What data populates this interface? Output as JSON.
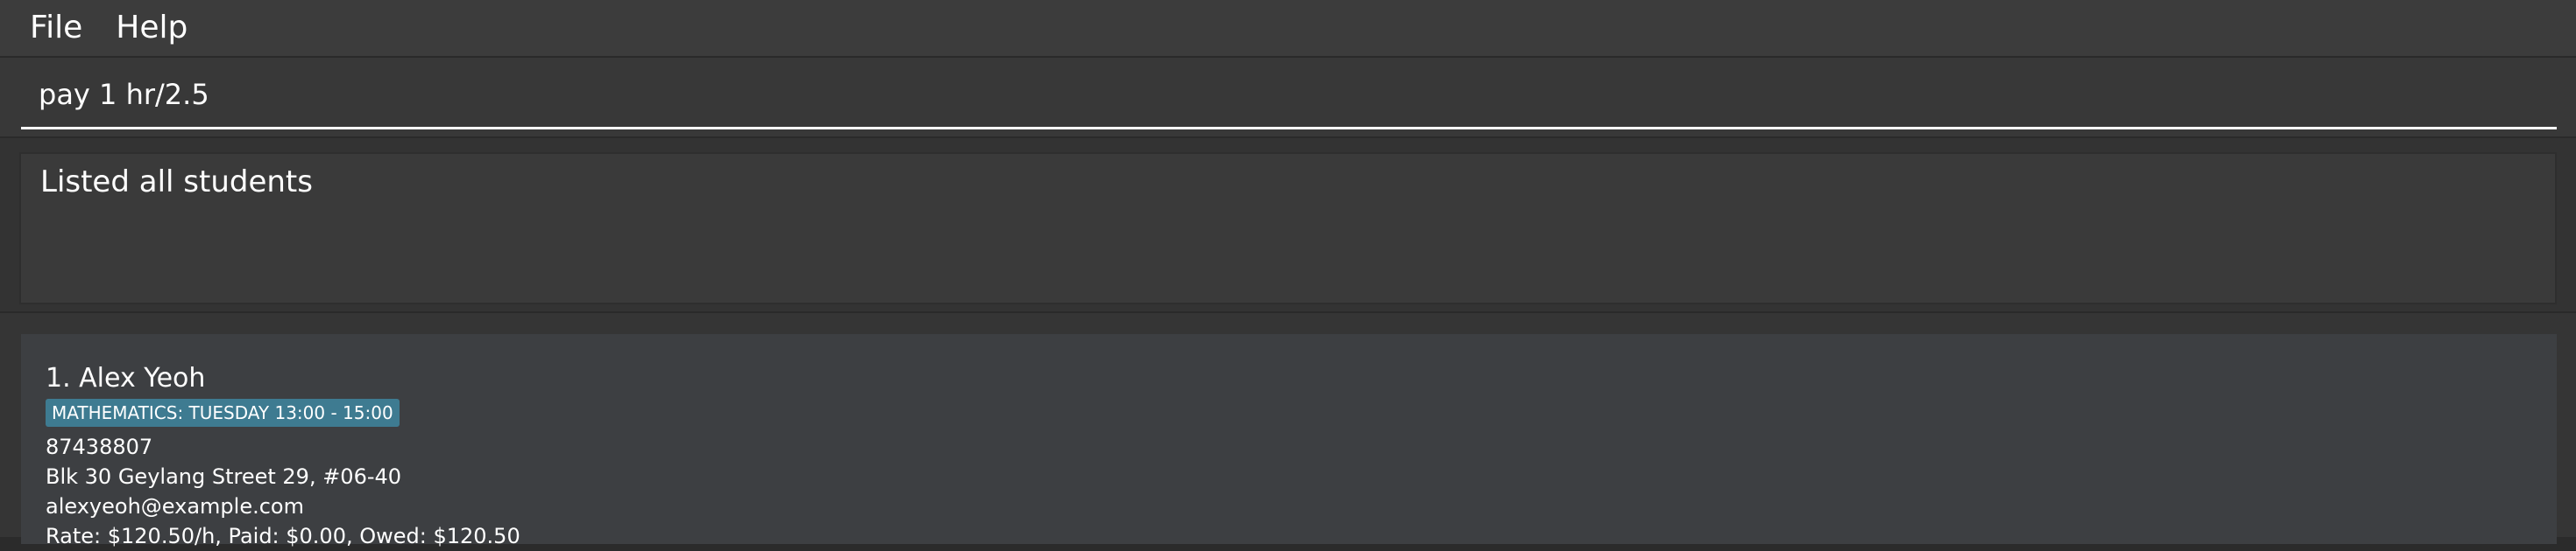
{
  "menu": {
    "file_label": "File",
    "help_label": "Help"
  },
  "command": {
    "value": "pay 1 hr/2.5"
  },
  "result": {
    "message": "Listed all students"
  },
  "students": [
    {
      "index_name": "1. Alex Yeoh",
      "tag": "MATHEMATICS: TUESDAY 13:00 - 15:00",
      "phone": "87438807",
      "address": "Blk 30 Geylang Street 29, #06-40",
      "email": "alexyeoh@example.com",
      "payment": "Rate: $120.50/h, Paid: $0.00, Owed: $120.50"
    }
  ],
  "colors": {
    "tag_background": "#3e7b91",
    "menubar": "#3c3c3c",
    "card": "#3d3f42"
  }
}
